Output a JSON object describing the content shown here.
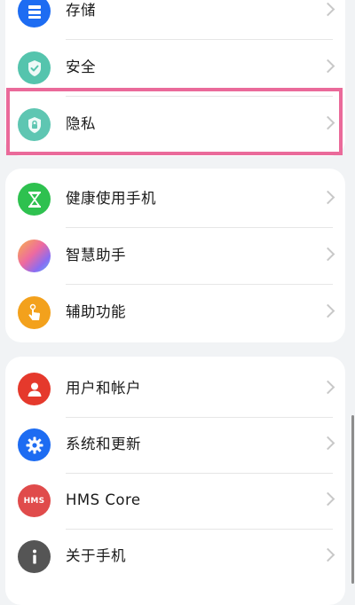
{
  "group1": {
    "items": [
      {
        "label": "存储",
        "icon": "storage-icon"
      },
      {
        "label": "安全",
        "icon": "shield-check-icon"
      },
      {
        "label": "隐私",
        "icon": "privacy-shield-icon"
      }
    ]
  },
  "group2": {
    "items": [
      {
        "label": "健康使用手机",
        "icon": "hourglass-icon"
      },
      {
        "label": "智慧助手",
        "icon": "gradient-orb-icon"
      },
      {
        "label": "辅助功能",
        "icon": "hand-tap-icon"
      }
    ]
  },
  "group3": {
    "items": [
      {
        "label": "用户和帐户",
        "icon": "user-icon"
      },
      {
        "label": "系统和更新",
        "icon": "gear-icon"
      },
      {
        "label": "HMS Core",
        "icon": "hms-icon",
        "icon_text": "HMS"
      },
      {
        "label": "关于手机",
        "icon": "info-icon"
      }
    ]
  },
  "colors": {
    "storage": "#1d6cf2",
    "security": "#55c4ad",
    "privacy": "#5ec6b2",
    "hourglass": "#2ec14f",
    "accessibility": "#f3a11c",
    "user": "#e5392c",
    "system": "#1d6cf2",
    "hms": "#e04b4b",
    "info": "#555555",
    "highlight": "#ea6a9a"
  }
}
